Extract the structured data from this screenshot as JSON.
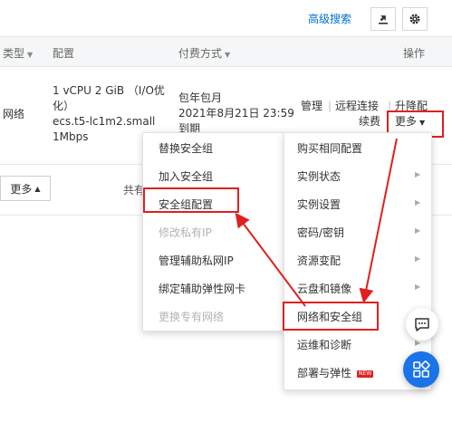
{
  "toolbar": {
    "advanced_search": "高级搜索",
    "export_icon": "export-icon",
    "settings_icon": "gear-icon"
  },
  "table": {
    "headers": {
      "type": "类型",
      "config": "配置",
      "payment": "付费方式",
      "actions": "操作"
    },
    "row": {
      "network": "网络",
      "config_line1": "1 vCPU 2 GiB （I/O优",
      "config_line2": "化）",
      "instance_type": "ecs.t5-lc1m2.small",
      "bandwidth": "1Mbps",
      "pay_type": "包年包月",
      "expire": "2021年8月21日 23:59",
      "expire_suffix": "到期",
      "action_manage": "管理",
      "action_sep1": "|",
      "action_remote": "远程连接",
      "action_sep2": "|",
      "action_upgrade": "升降配",
      "action_renew": "续费",
      "action_more": "更多"
    }
  },
  "footer": {
    "more": "更多",
    "total_prefix": "共有"
  },
  "submenu_left": {
    "items": [
      {
        "label": "替换安全组",
        "disabled": false
      },
      {
        "label": "加入安全组",
        "disabled": false
      },
      {
        "label": "安全组配置",
        "disabled": false
      },
      {
        "label": "修改私有IP",
        "disabled": true
      },
      {
        "label": "管理辅助私网IP",
        "disabled": false
      },
      {
        "label": "绑定辅助弹性网卡",
        "disabled": false
      },
      {
        "label": "更换专有网络",
        "disabled": true
      }
    ]
  },
  "menu_right": {
    "items": [
      {
        "label": "购买相同配置"
      },
      {
        "label": "实例状态"
      },
      {
        "label": "实例设置"
      },
      {
        "label": "密码/密钥"
      },
      {
        "label": "资源变配"
      },
      {
        "label": "云盘和镜像"
      },
      {
        "label": "网络和安全组"
      },
      {
        "label": "运维和诊断"
      },
      {
        "label": "部署与弹性"
      }
    ],
    "new_badge": "NEW"
  },
  "colors": {
    "link": "#0070cc",
    "highlight": "#e02020",
    "fab_blue": "#1a73e8"
  }
}
